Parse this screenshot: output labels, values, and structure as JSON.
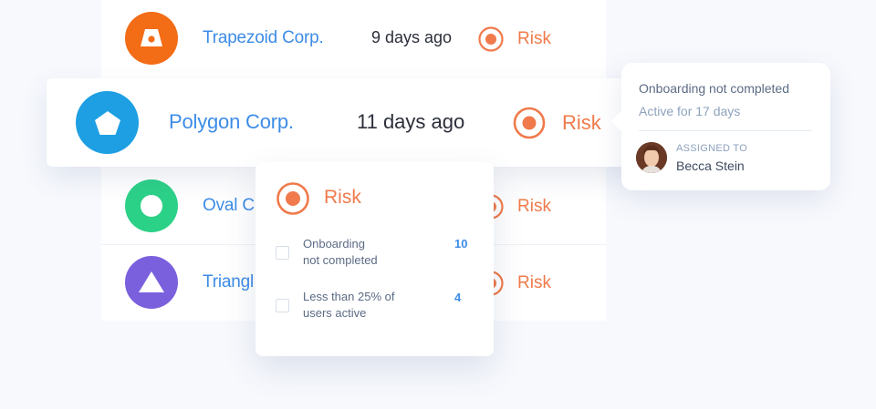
{
  "rows": [
    {
      "company": "Trapezoid Corp.",
      "time": "9 days ago",
      "status": "Risk",
      "logo_color": "#f36c16",
      "logo_icon": "trapezoid-icon"
    },
    {
      "company": "Polygon Corp.",
      "time": "11 days ago",
      "status": "Risk",
      "logo_color": "#1e9fe3",
      "logo_icon": "pentagon-icon"
    },
    {
      "company": "Oval C",
      "status": "Risk",
      "logo_color": "#2cd188",
      "logo_icon": "circle-icon"
    },
    {
      "company": "Triangl",
      "status": "Risk",
      "logo_color": "#7b60dd",
      "logo_icon": "triangle-icon"
    }
  ],
  "tooltip": {
    "title": "Onboarding not completed",
    "subtitle": "Active for 17 days",
    "assigned_label": "ASSIGNED TO",
    "assignee": "Becca Stein"
  },
  "popover": {
    "title": "Risk",
    "items": [
      {
        "line1": "Onboarding",
        "line2": "not completed",
        "count": "10"
      },
      {
        "line1": "Less than 25% of",
        "line2": "users active",
        "count": "4"
      }
    ]
  },
  "colors": {
    "risk": "#f07a4b",
    "link": "#3d8ce6",
    "background": "#f7f9fd"
  }
}
